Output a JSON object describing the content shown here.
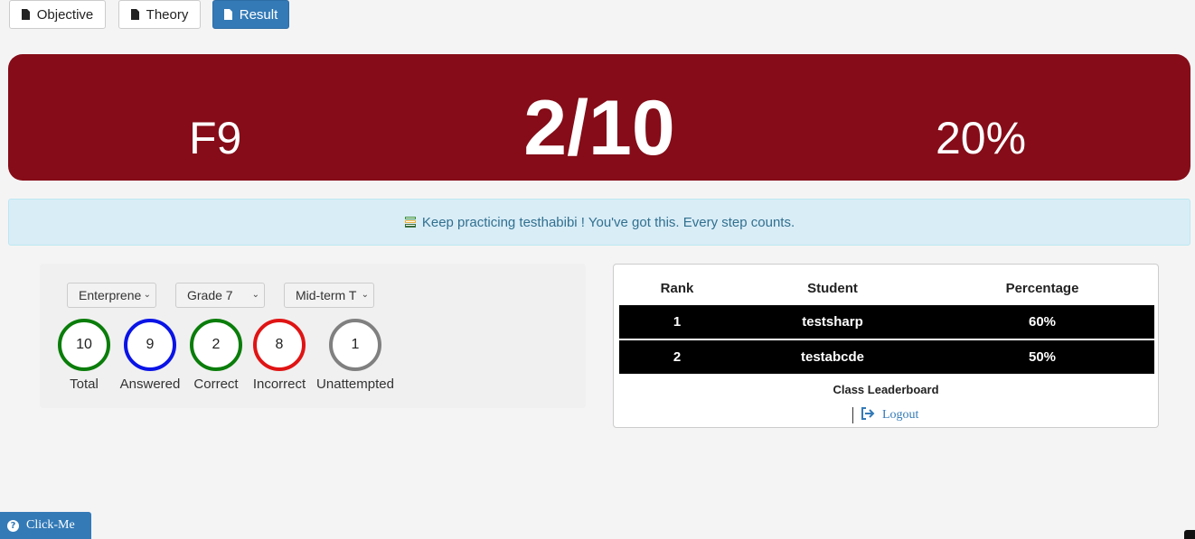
{
  "tabs": [
    {
      "label": "Objective",
      "icon": "document-icon",
      "active": false
    },
    {
      "label": "Theory",
      "icon": "document-icon",
      "active": false
    },
    {
      "label": "Result",
      "icon": "document-icon",
      "active": true
    }
  ],
  "score": {
    "grade": "F9",
    "fraction": "2/10",
    "percent": "20%",
    "banner_color": "#850c18"
  },
  "alert": {
    "icon": "books-icon",
    "message": "Keep practicing testhabibi ! You've got this. Every step counts."
  },
  "filters": [
    {
      "value": "Enterprene"
    },
    {
      "value": "Grade 7"
    },
    {
      "value": "Mid-term T"
    }
  ],
  "stats": [
    {
      "value": "10",
      "label": "Total",
      "color": "#0a7d0a"
    },
    {
      "value": "9",
      "label": "Answered",
      "color": "#0a14e6"
    },
    {
      "value": "2",
      "label": "Correct",
      "color": "#0a7d0a"
    },
    {
      "value": "8",
      "label": "Incorrect",
      "color": "#e01414"
    },
    {
      "value": "1",
      "label": "Unattempted",
      "color": "#808080"
    }
  ],
  "leaderboard": {
    "headers": [
      "Rank",
      "Student",
      "Percentage"
    ],
    "rows": [
      [
        "1",
        "testsharp",
        "60%"
      ],
      [
        "2",
        "testabcde",
        "50%"
      ]
    ],
    "caption": "Class Leaderboard",
    "logout_label": "Logout"
  },
  "help_button": {
    "label": "Click-Me",
    "icon": "question-circle-icon"
  }
}
